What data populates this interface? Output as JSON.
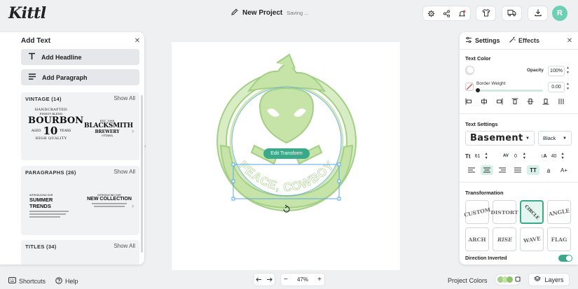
{
  "app": {
    "logo": "Kittl",
    "project_name": "New Project",
    "save_status": "Saving ...",
    "avatar_letter": "R"
  },
  "left_panel": {
    "title": "Add Text",
    "headline_btn": "Add Headline",
    "paragraph_btn": "Add Paragraph",
    "sections": [
      {
        "title": "VINTAGE (14)",
        "show_all": "Show All",
        "previews": [
          {
            "top": "HANDCRAFTED",
            "sub": "FINEST BLEND",
            "main": "BOURBON",
            "num_left": "AGED",
            "num": "10",
            "num_right": "YEARS",
            "bottom": "HIGH QUALITY"
          },
          {
            "top": "EST. 1988",
            "main": "BLACKSMITH",
            "sub": "BREWERY",
            "bottom": "OTTAWA"
          }
        ]
      },
      {
        "title": "PARAGRAPHS (26)",
        "show_all": "Show All",
        "previews": [
          {
            "kicker": "INTRODUCING OUR",
            "main": "SUMMER TRENDS"
          },
          {
            "kicker": "INTRODUCING OUR",
            "main": "NEW COLLECTION"
          }
        ]
      },
      {
        "title": "TITLES (34)",
        "show_all": "Show All"
      }
    ]
  },
  "canvas": {
    "arc_text": "PEACE, COWBOY",
    "edit_transform": "Edit Transform",
    "shape_color": "#c6e3a8",
    "shape_stroke": "#a3cf86",
    "selection_color": "#5aa9e6"
  },
  "bottom_bar": {
    "shortcuts": "Shortcuts",
    "help": "Help",
    "zoom": "47%",
    "project_colors": "Project Colors",
    "layers": "Layers"
  },
  "right_panel": {
    "tabs": [
      {
        "label": "Settings"
      },
      {
        "label": "Effects"
      }
    ],
    "text_color_label": "Text Color",
    "opacity_label": "Opacity",
    "opacity_value": "100%",
    "border_weight_label": "Border Weight",
    "border_weight_value": "0.00",
    "text_settings_label": "Text Settings",
    "font_name": "Basement",
    "font_weight": "Black",
    "font_size": "61",
    "letter_spacing": "0",
    "line_height": "40",
    "transformation_label": "Transformation",
    "transformations": [
      "CUSTOM",
      "DISTORT",
      "CIRCLE",
      "ANGLE",
      "ARCH",
      "RISE",
      "WAVE",
      "FLAG"
    ],
    "active_transformation": "CIRCLE",
    "direction_label": "Direction Inverted",
    "direction_inverted": true,
    "accent_color": "#3aa98a"
  }
}
